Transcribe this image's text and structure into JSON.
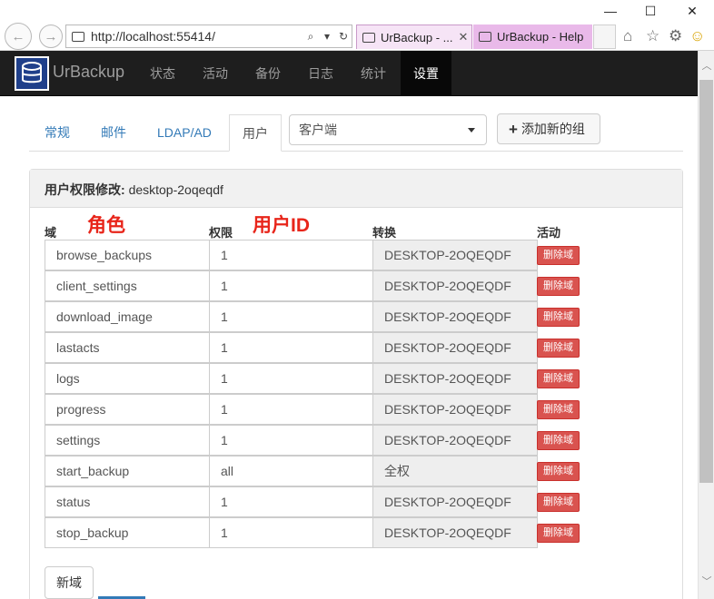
{
  "window": {
    "minimize_glyph": "—",
    "maximize_glyph": "☐",
    "close_glyph": "✕"
  },
  "browser": {
    "url": "http://localhost:55414/",
    "search_glyph": "⌕",
    "dropdown_glyph": "▾",
    "refresh_glyph": "↻",
    "back_glyph": "←",
    "forward_glyph": "→",
    "tabs": [
      {
        "title": "UrBackup - ...",
        "close": "✕"
      },
      {
        "title": "UrBackup - Help"
      }
    ],
    "toolbar_icons": {
      "home": "⌂",
      "favorites": "☆",
      "settings": "⚙",
      "feedback": "☺"
    }
  },
  "app": {
    "brand": "UrBackup",
    "nav": [
      "状态",
      "活动",
      "备份",
      "日志",
      "统计",
      "设置"
    ],
    "active_nav": "设置"
  },
  "settings_tabs": [
    "常规",
    "邮件",
    "LDAP/AD",
    "用户"
  ],
  "active_tab": "用户",
  "group_select": {
    "value": "客户端"
  },
  "add_group_button": {
    "icon": "+",
    "label": "添加新的组"
  },
  "panel": {
    "heading_label": "用户权限修改:",
    "heading_value": "desktop-2oqeqdf"
  },
  "columns": [
    "域",
    "权限",
    "转换",
    "活动"
  ],
  "annotations": {
    "role": "角色",
    "user_id": "用户ID"
  },
  "rows": [
    {
      "domain": "browse_backups",
      "permission": "1",
      "conversion": "DESKTOP-2OQEQDF",
      "action": "删除域"
    },
    {
      "domain": "client_settings",
      "permission": "1",
      "conversion": "DESKTOP-2OQEQDF",
      "action": "删除域"
    },
    {
      "domain": "download_image",
      "permission": "1",
      "conversion": "DESKTOP-2OQEQDF",
      "action": "删除域"
    },
    {
      "domain": "lastacts",
      "permission": "1",
      "conversion": "DESKTOP-2OQEQDF",
      "action": "删除域"
    },
    {
      "domain": "logs",
      "permission": "1",
      "conversion": "DESKTOP-2OQEQDF",
      "action": "删除域"
    },
    {
      "domain": "progress",
      "permission": "1",
      "conversion": "DESKTOP-2OQEQDF",
      "action": "删除域"
    },
    {
      "domain": "settings",
      "permission": "1",
      "conversion": "DESKTOP-2OQEQDF",
      "action": "删除域"
    },
    {
      "domain": "start_backup",
      "permission": "all",
      "conversion": "全权",
      "action": "删除域"
    },
    {
      "domain": "status",
      "permission": "1",
      "conversion": "DESKTOP-2OQEQDF",
      "action": "删除域"
    },
    {
      "domain": "stop_backup",
      "permission": "1",
      "conversion": "DESKTOP-2OQEQDF",
      "action": "删除域"
    }
  ],
  "new_domain_button": "新域",
  "scrollbar": {
    "up": "︿",
    "down": "﹀"
  }
}
